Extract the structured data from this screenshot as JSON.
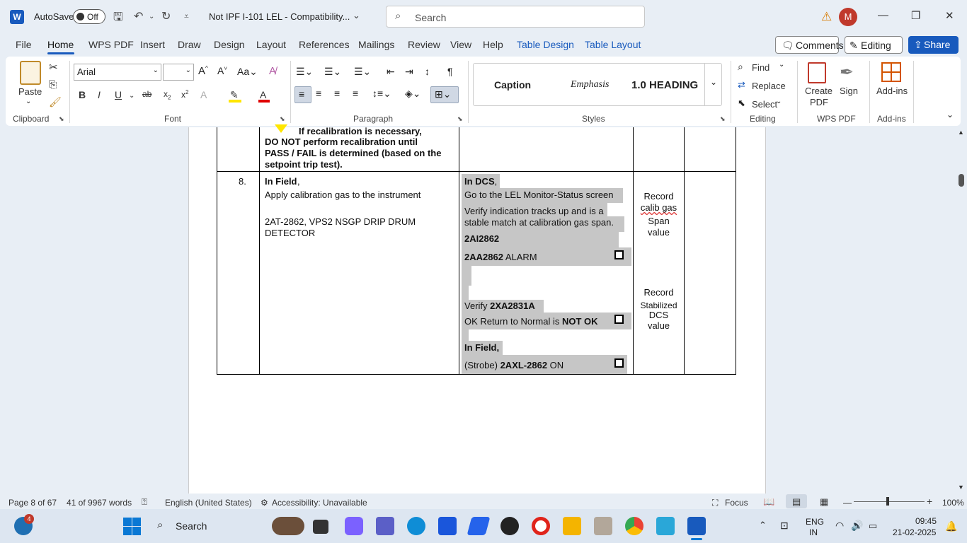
{
  "titlebar": {
    "app_letter": "W",
    "autosave_label": "AutoSave",
    "autosave_state": "Off",
    "doc_title": "Not IPF I-101 LEL  -  Compatibility...",
    "search_placeholder": "Search",
    "avatar_initial": "M"
  },
  "tabs": [
    "File",
    "Home",
    "WPS PDF",
    "Insert",
    "Draw",
    "Design",
    "Layout",
    "References",
    "Mailings",
    "Review",
    "View",
    "Help",
    "Table Design",
    "Table Layout"
  ],
  "actions": {
    "comments": "Comments",
    "editing": "Editing",
    "share": "Share"
  },
  "ribbon": {
    "clipboard": {
      "paste": "Paste",
      "label": "Clipboard"
    },
    "font": {
      "name": "Arial",
      "size": "",
      "label": "Font"
    },
    "paragraph": {
      "label": "Paragraph"
    },
    "styles": {
      "items": [
        "Caption",
        "Emphasis",
        "1.0  HEADING"
      ],
      "label": "Styles"
    },
    "editing": {
      "find": "Find",
      "replace": "Replace",
      "select": "Select",
      "label": "Editing"
    },
    "wps": {
      "create_pdf_line1": "Create",
      "create_pdf_line2": "PDF",
      "sign": "Sign",
      "label": "WPS PDF"
    },
    "addins": {
      "button": "Add-ins",
      "label": "Add-ins"
    }
  },
  "document": {
    "prev_row_text": [
      "If recalibration is necessary,",
      "DO NOT perform recalibration until",
      "PASS / FAIL is determined (based on the",
      "setpoint trip test)."
    ],
    "row_number": "8.",
    "col2": {
      "in_field": "In Field",
      "in_field_comma": ",",
      "apply": "Apply calibration gas to the instrument",
      "tag_line1": "2AT-2862, VPS2 NSGP DRIP DRUM",
      "tag_line2": "DETECTOR"
    },
    "col3": {
      "in_dcs": "In DCS",
      "in_dcs_comma": ",",
      "goto": "Go to the LEL Monitor-Status screen",
      "verify1": "Verify indication tracks up and is a",
      "verify2": "stable match at calibration gas span.",
      "tag_ai": "2AI2862",
      "tag_aa": "2AA2862",
      "alarm": " ALARM",
      "verify_xa_prefix": "Verify ",
      "verify_xa_tag": "2XA2831A",
      "ok_return": "OK Return to Normal is ",
      "not_ok": "NOT OK",
      "in_field2": "In Field,",
      "strobe_prefix": "(Strobe) ",
      "strobe_tag": "2AXL-2862",
      "strobe_on": " ON"
    },
    "col4": {
      "record1": [
        "Record",
        "calib gas",
        "Span",
        "value"
      ],
      "record2": [
        "Record",
        "Stabilized",
        "DCS",
        "value"
      ]
    }
  },
  "statusbar": {
    "page": "Page 8 of 67",
    "words": "41 of 9967 words",
    "language": "English (United States)",
    "accessibility": "Accessibility: Unavailable",
    "focus": "Focus",
    "zoom": "100%"
  },
  "taskbar": {
    "badge": "4",
    "search": "Search",
    "lang1": "ENG",
    "lang2": "IN",
    "time": "09:45",
    "date": "21-02-2025"
  }
}
